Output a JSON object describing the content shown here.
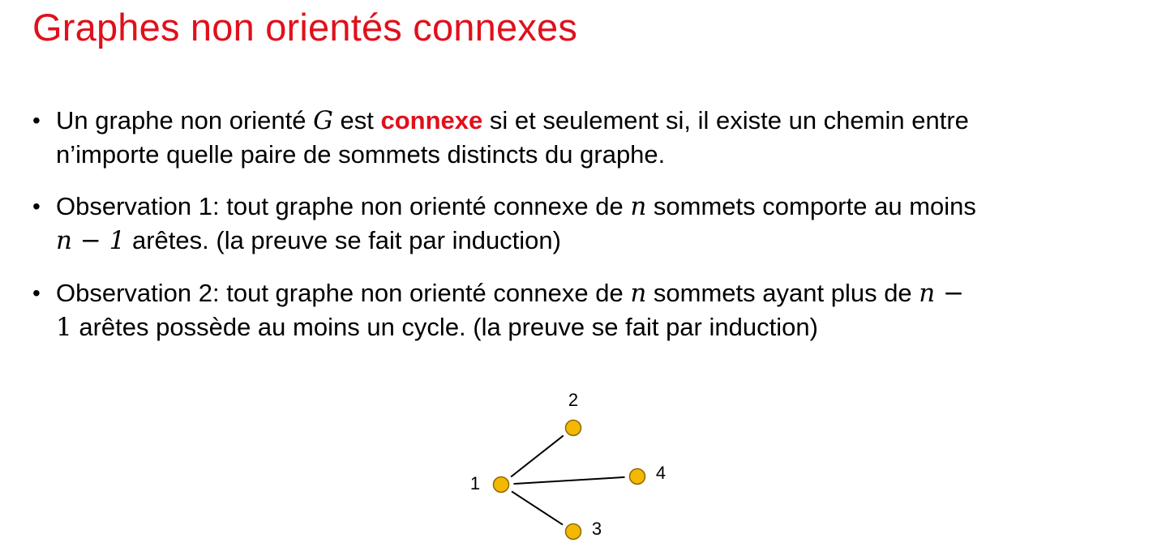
{
  "slide": {
    "title": "Graphes non orientés connexes"
  },
  "bullets": [
    {
      "line1_a": "Un graphe non orienté ",
      "line1_math": "G",
      "line1_b": " est ",
      "line1_highlight": "connexe",
      "line1_c": " si et seulement si, il existe un chemin entre",
      "line2": "n’importe quelle paire de sommets distincts du graphe."
    },
    {
      "line1_a": "Observation 1: tout graphe non orienté connexe de ",
      "line1_math": "n",
      "line1_b": " sommets comporte au moins",
      "line2_math": "n − 1",
      "line2_text": " arêtes. (la preuve se fait par induction)"
    },
    {
      "line1_a": "Observation 2: tout graphe non orienté connexe de ",
      "line1_math": "n",
      "line1_b": " sommets ayant plus de ",
      "line1_math2": "n −",
      "line2_math": "1",
      "line2_text": " arêtes possède au moins un cycle. (la preuve se fait par induction)"
    }
  ],
  "graph": {
    "node_color": "#f5b800",
    "node_stroke": "#8a6a00",
    "edge_color": "#000000",
    "nodes": [
      {
        "id": "1",
        "label": "1"
      },
      {
        "id": "2",
        "label": "2"
      },
      {
        "id": "3",
        "label": "3"
      },
      {
        "id": "4",
        "label": "4"
      }
    ],
    "edges": [
      {
        "from": "1",
        "to": "2"
      },
      {
        "from": "1",
        "to": "3"
      },
      {
        "from": "1",
        "to": "4"
      }
    ]
  }
}
